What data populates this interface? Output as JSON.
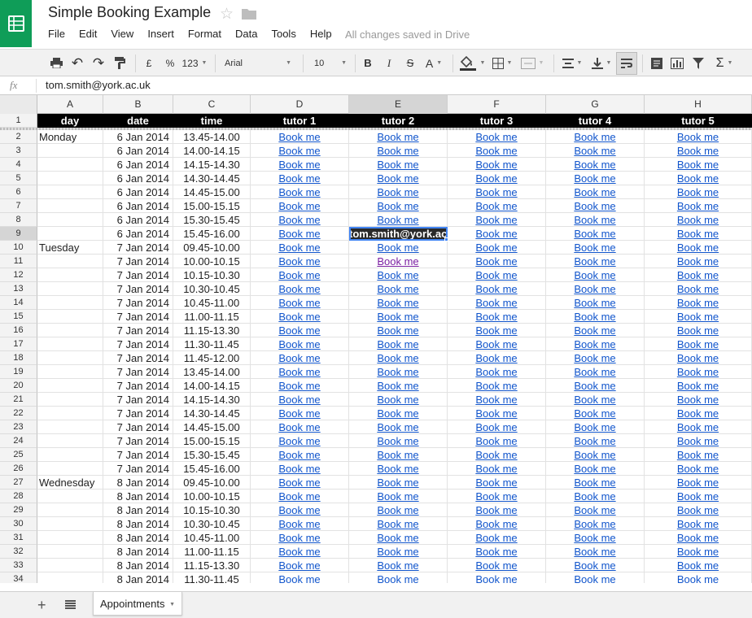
{
  "app": {
    "title": "Simple Booking Example",
    "save_status": "All changes saved in Drive",
    "menu": [
      "File",
      "Edit",
      "View",
      "Insert",
      "Format",
      "Data",
      "Tools",
      "Help"
    ]
  },
  "toolbar": {
    "currency": "£",
    "percent": "%",
    "number_format": "123",
    "font": "Arial",
    "font_size": "10",
    "bold": "B",
    "italic": "I",
    "strikethrough": "S",
    "text_color": "A"
  },
  "formula_bar": {
    "fx": "fx",
    "value": "tom.smith@york.ac.uk"
  },
  "columns": [
    "A",
    "B",
    "C",
    "D",
    "E",
    "F",
    "G",
    "H"
  ],
  "active_column": "E",
  "header_row": [
    "day",
    "date",
    "time",
    "tutor 1",
    "tutor 2",
    "tutor 3",
    "tutor 4",
    "tutor 5"
  ],
  "book_label": "Book me",
  "rows": [
    {
      "n": "2",
      "day": "Monday",
      "date": "6 Jan 2014",
      "time": "13.45-14.00"
    },
    {
      "n": "3",
      "day": "",
      "date": "6 Jan 2014",
      "time": "14.00-14.15"
    },
    {
      "n": "4",
      "day": "",
      "date": "6 Jan 2014",
      "time": "14.15-14.30"
    },
    {
      "n": "5",
      "day": "",
      "date": "6 Jan 2014",
      "time": "14.30-14.45"
    },
    {
      "n": "6",
      "day": "",
      "date": "6 Jan 2014",
      "time": "14.45-15.00"
    },
    {
      "n": "7",
      "day": "",
      "date": "6 Jan 2014",
      "time": "15.00-15.15"
    },
    {
      "n": "8",
      "day": "",
      "date": "6 Jan 2014",
      "time": "15.30-15.45"
    },
    {
      "n": "9",
      "day": "",
      "date": "6 Jan 2014",
      "time": "15.45-16.00",
      "tutor2": "tom.smith@york.ac.",
      "selected": true
    },
    {
      "n": "10",
      "day": "Tuesday",
      "date": "7 Jan 2014",
      "time": "09.45-10.00"
    },
    {
      "n": "11",
      "day": "",
      "date": "7 Jan 2014",
      "time": "10.00-10.15",
      "visited": true
    },
    {
      "n": "12",
      "day": "",
      "date": "7 Jan 2014",
      "time": "10.15-10.30"
    },
    {
      "n": "13",
      "day": "",
      "date": "7 Jan 2014",
      "time": "10.30-10.45"
    },
    {
      "n": "14",
      "day": "",
      "date": "7 Jan 2014",
      "time": "10.45-11.00"
    },
    {
      "n": "15",
      "day": "",
      "date": "7 Jan 2014",
      "time": "11.00-11.15"
    },
    {
      "n": "16",
      "day": "",
      "date": "7 Jan 2014",
      "time": "11.15-13.30"
    },
    {
      "n": "17",
      "day": "",
      "date": "7 Jan 2014",
      "time": "11.30-11.45"
    },
    {
      "n": "18",
      "day": "",
      "date": "7 Jan 2014",
      "time": "11.45-12.00"
    },
    {
      "n": "19",
      "day": "",
      "date": "7 Jan 2014",
      "time": "13.45-14.00"
    },
    {
      "n": "20",
      "day": "",
      "date": "7 Jan 2014",
      "time": "14.00-14.15"
    },
    {
      "n": "21",
      "day": "",
      "date": "7 Jan 2014",
      "time": "14.15-14.30"
    },
    {
      "n": "22",
      "day": "",
      "date": "7 Jan 2014",
      "time": "14.30-14.45"
    },
    {
      "n": "23",
      "day": "",
      "date": "7 Jan 2014",
      "time": "14.45-15.00"
    },
    {
      "n": "24",
      "day": "",
      "date": "7 Jan 2014",
      "time": "15.00-15.15"
    },
    {
      "n": "25",
      "day": "",
      "date": "7 Jan 2014",
      "time": "15.30-15.45"
    },
    {
      "n": "26",
      "day": "",
      "date": "7 Jan 2014",
      "time": "15.45-16.00"
    },
    {
      "n": "27",
      "day": "Wednesday",
      "date": "8 Jan 2014",
      "time": "09.45-10.00"
    },
    {
      "n": "28",
      "day": "",
      "date": "8 Jan 2014",
      "time": "10.00-10.15"
    },
    {
      "n": "29",
      "day": "",
      "date": "8 Jan 2014",
      "time": "10.15-10.30"
    },
    {
      "n": "30",
      "day": "",
      "date": "8 Jan 2014",
      "time": "10.30-10.45"
    },
    {
      "n": "31",
      "day": "",
      "date": "8 Jan 2014",
      "time": "10.45-11.00"
    },
    {
      "n": "32",
      "day": "",
      "date": "8 Jan 2014",
      "time": "11.00-11.15"
    },
    {
      "n": "33",
      "day": "",
      "date": "8 Jan 2014",
      "time": "11.15-13.30"
    },
    {
      "n": "34",
      "day": "",
      "date": "8 Jan 2014",
      "time": "11.30-11.45"
    }
  ],
  "sheets": [
    {
      "name": "Appointments",
      "active": true
    }
  ],
  "colors": {
    "brand": "#0f9d58",
    "link": "#1155cc",
    "visited_link": "#7b1fa2",
    "selection": "#4285f4",
    "header_row_bg": "#000000"
  }
}
